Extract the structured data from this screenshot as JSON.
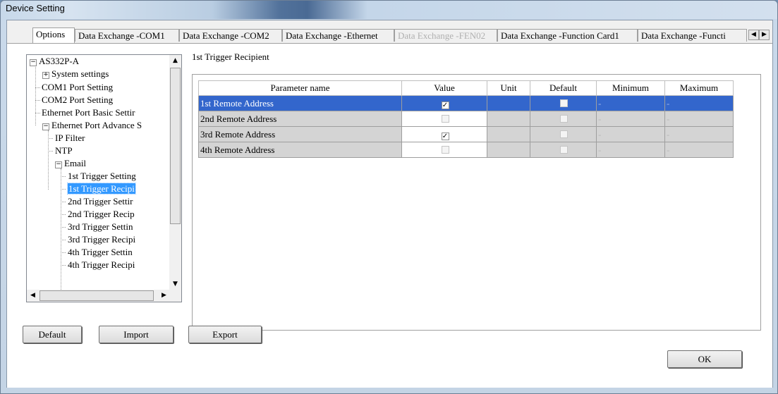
{
  "window": {
    "title": "Device Setting"
  },
  "tabs": [
    "Options",
    "Data Exchange -COM1",
    "Data Exchange -COM2",
    "Data Exchange -Ethernet",
    "Data Exchange -FEN02",
    "Data Exchange -Function Card1",
    "Data Exchange -Functi"
  ],
  "tab_scroll": {
    "left": "◀",
    "right": "▶"
  },
  "tree": {
    "items": [
      "AS332P-A",
      "System settings",
      "COM1 Port Setting",
      "COM2 Port Setting",
      "Ethernet Port Basic Settir",
      "Ethernet Port Advance S",
      "IP Filter",
      "NTP",
      "Email",
      "1st Trigger Setting",
      "1st Trigger Recipi",
      "2nd Trigger Settir",
      "2nd Trigger Recip",
      "3rd Trigger Settin",
      "3rd Trigger Recipi",
      "4th Trigger Settin",
      "4th Trigger Recipi"
    ],
    "expanders": {
      "collapse": "−",
      "expand": "+"
    }
  },
  "section_title": "1st Trigger Recipient",
  "table": {
    "headers": [
      "Parameter name",
      "Value",
      "Unit",
      "Default",
      "Minimum",
      "Maximum"
    ],
    "rows": [
      {
        "name": "1st Remote Address",
        "value": true,
        "value_enabled": true,
        "unit": "",
        "default": false,
        "minimum": "-",
        "maximum": "-"
      },
      {
        "name": "2nd Remote Address",
        "value": false,
        "value_enabled": false,
        "unit": "",
        "default": false,
        "minimum": "-",
        "maximum": "-"
      },
      {
        "name": "3rd Remote Address",
        "value": true,
        "value_enabled": true,
        "unit": "",
        "default": false,
        "minimum": "-",
        "maximum": "-"
      },
      {
        "name": "4th Remote Address",
        "value": false,
        "value_enabled": false,
        "unit": "",
        "default": false,
        "minimum": "-",
        "maximum": "-"
      }
    ],
    "check_glyph": "✓"
  },
  "buttons": {
    "default": "Default",
    "import": "Import",
    "export": "Export",
    "ok": "OK"
  },
  "colors": {
    "selection": "#3366cc",
    "tree_selection": "#3399ff",
    "row_gray": "#d4d4d4"
  }
}
